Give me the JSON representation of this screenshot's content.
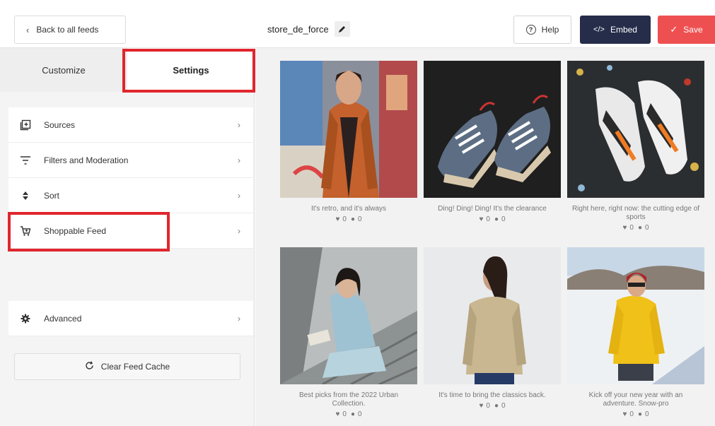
{
  "topbar": {
    "back_label": "Back to all feeds",
    "feed_name": "store_de_force",
    "help_label": "Help",
    "embed_label": "Embed",
    "save_label": "Save"
  },
  "sidebar": {
    "tabs": [
      {
        "label": "Customize",
        "active": false
      },
      {
        "label": "Settings",
        "active": true
      }
    ],
    "items": [
      {
        "label": "Sources",
        "icon": "plus-square-icon"
      },
      {
        "label": "Filters and Moderation",
        "icon": "filter-icon"
      },
      {
        "label": "Sort",
        "icon": "sort-icon"
      },
      {
        "label": "Shoppable Feed",
        "icon": "cart-icon"
      },
      {
        "label": "Advanced",
        "icon": "gear-icon"
      }
    ],
    "clear_cache_label": "Clear Feed Cache"
  },
  "posts": [
    {
      "caption": "It's retro, and it's always",
      "likes": "0",
      "comments": "0"
    },
    {
      "caption": "Ding! Ding! Ding! It's the clearance",
      "likes": "0",
      "comments": "0"
    },
    {
      "caption": "Right here, right now: the cutting edge of sports",
      "likes": "0",
      "comments": "0"
    },
    {
      "caption": "Best picks from the 2022 Urban Collection.",
      "likes": "0",
      "comments": "0"
    },
    {
      "caption": "It's time to bring the classics back.",
      "likes": "0",
      "comments": "0"
    },
    {
      "caption": "Kick off your new year with an adventure. Snow-pro",
      "likes": "0",
      "comments": "0"
    }
  ],
  "colors": {
    "embed_bg": "#252d4a",
    "save_bg": "#ee5051",
    "highlight": "#e0262d"
  }
}
